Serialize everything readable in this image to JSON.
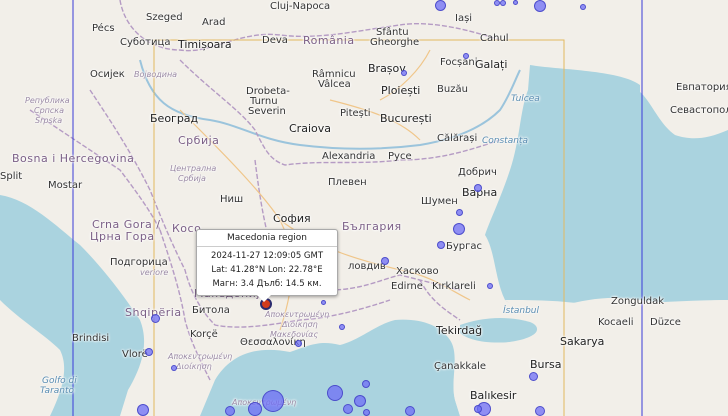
{
  "popup": {
    "title": "Macedonia region",
    "time": "2024-11-27 12:09:05 GMT",
    "coords": "Lat: 41.28°N Lon: 22.78°E",
    "magnitude": "Магн: 3.4 Дълб: 14.5 км."
  },
  "labels": {
    "pecs": "Pécs",
    "szeged": "Szeged",
    "arad": "Arad",
    "cluj": "Cluj-Napoca",
    "sfantu": "Sfântu",
    "gheorghe": "Gheorghe",
    "iasi_top": "Iași",
    "subotica": "Суботица",
    "timisoara": "Timișoara",
    "deva": "Deva",
    "romania": "România",
    "focsani": "Focșani",
    "cahul": "Cahul",
    "galati": "Galați",
    "brasov": "Brașov",
    "osijek": "Осијек",
    "vojvodina": "Војводина",
    "ramnicu": "Râmnicu",
    "valcea": "Vâlcea",
    "buzau": "Buzău",
    "ploiesti": "Ploiești",
    "tulcea": "Tulcea",
    "evpatoria": "Евпатория",
    "sevastopol": "Севастополь",
    "republika": "Република",
    "srpska1": "Српска",
    "srpska2": "Srpska",
    "beograd": "Београд",
    "drobeta": "Drobeta-",
    "turnu": "Turnu",
    "severin": "Severin",
    "pitesti": "Pitești",
    "bucuresti": "București",
    "srbija": "Србија",
    "craiova": "Craiova",
    "calarasi": "Călărași",
    "constanta": "Constanța",
    "bosna": "Bosna i Hercegovina",
    "alexandria": "Alexandria",
    "ruse": "Русе",
    "split": "Split",
    "mostar": "Mostar",
    "centralna1": "Централна",
    "centralna2": "Србија",
    "pleven": "Плевен",
    "dobrich": "Добрич",
    "varna": "Варна",
    "shumen": "Шумен",
    "nish": "Ниш",
    "crnagora": "Crna Gora /",
    "crnagora2": "Црна Гора",
    "kosovo": "Косо",
    "sofia": "София",
    "bulgaria": "България",
    "burgas": "Бургас",
    "podgorica": "Подгорица",
    "vetiore": "veriore",
    "plovdiv": "ловдив",
    "haskovo": "Хасково",
    "makedonija": "Македонија",
    "edirne": "Edirne",
    "kirklareli": "Kırklareli",
    "zonguldak": "Zonguldak",
    "shqiperia": "Shqipëria",
    "bitola": "Битола",
    "apokentromeni1": "Αποκεντρωμένη",
    "apokentromeni2": "Διοίκηση",
    "apokentromeni3": "Μακεδονίας",
    "istanbul": "İstanbul",
    "tekirdag": "Tekirdağ",
    "kocaeli": "Kocaeli",
    "duzce": "Düzce",
    "korce": "Korçë",
    "thessaloniki": "Θεσσαλονίκη",
    "brindisi": "Brindisi",
    "vlore": "Vlorë",
    "sakarya": "Sakarya",
    "bursa": "Bursa",
    "canakkale": "Çanakkale",
    "balikesir": "Balıkesir",
    "golfo1": "Golfo di",
    "golfo2": "Taranto",
    "ipeiros1": "Αποκεντρωμένη",
    "ipeiros2": "Διοίκηση",
    "thessalias": "Αποκεντρωμένη"
  },
  "quakes": [
    {
      "lat": 45.8,
      "lon": 27.2,
      "size": 12
    },
    {
      "lat": 45.6,
      "lon": 25.6,
      "size": 11
    },
    {
      "lat": 45.6,
      "lon": 26.5,
      "size": 6
    },
    {
      "lat": 45.7,
      "lon": 26.6,
      "size": 6
    },
    {
      "lat": 45.9,
      "lon": 26.8,
      "size": 5
    },
    {
      "lat": 44.9,
      "lon": 27.9,
      "size": 6
    },
    {
      "lat": 44.3,
      "lon": 26.0,
      "size": 6
    },
    {
      "lat": 44.1,
      "lon": 25.0,
      "size": 6
    },
    {
      "lat": 42.2,
      "lon": 25.9,
      "size": 12
    },
    {
      "lat": 42.0,
      "lon": 25.6,
      "size": 8
    },
    {
      "lat": 42.4,
      "lon": 25.9,
      "size": 7
    },
    {
      "lat": 42.7,
      "lon": 26.2,
      "size": 8
    },
    {
      "lat": 41.8,
      "lon": 24.7,
      "size": 8
    },
    {
      "lat": 41.5,
      "lon": 26.4,
      "size": 6
    },
    {
      "lat": 41.1,
      "lon": 21.0,
      "size": 9
    },
    {
      "lat": 40.7,
      "lon": 20.9,
      "size": 8
    },
    {
      "lat": 40.5,
      "lon": 21.3,
      "size": 6
    },
    {
      "lat": 40.1,
      "lon": 22.9,
      "size": 22
    },
    {
      "lat": 40.0,
      "lon": 22.6,
      "size": 14
    },
    {
      "lat": 40.2,
      "lon": 23.9,
      "size": 16
    },
    {
      "lat": 40.1,
      "lon": 24.3,
      "size": 12
    },
    {
      "lat": 40.0,
      "lon": 24.1,
      "size": 10
    },
    {
      "lat": 40.3,
      "lon": 24.4,
      "size": 8
    },
    {
      "lat": 39.7,
      "lon": 22.2,
      "size": 10
    },
    {
      "lat": 39.2,
      "lon": 20.8,
      "size": 12
    },
    {
      "lat": 39.6,
      "lon": 24.4,
      "size": 7
    },
    {
      "lat": 39.5,
      "lon": 25.1,
      "size": 10
    },
    {
      "lat": 39.6,
      "lon": 26.3,
      "size": 14
    },
    {
      "lat": 40.0,
      "lon": 26.2,
      "size": 8
    },
    {
      "lat": 40.4,
      "lon": 27.1,
      "size": 9
    },
    {
      "lat": 39.3,
      "lon": 27.2,
      "size": 10
    },
    {
      "lat": 41.0,
      "lon": 24.0,
      "size": 6
    },
    {
      "lat": 40.8,
      "lon": 23.3,
      "size": 7
    },
    {
      "lat": 41.3,
      "lon": 23.7,
      "size": 5
    }
  ],
  "selected": {
    "lat": 41.28,
    "lon": 22.78
  }
}
